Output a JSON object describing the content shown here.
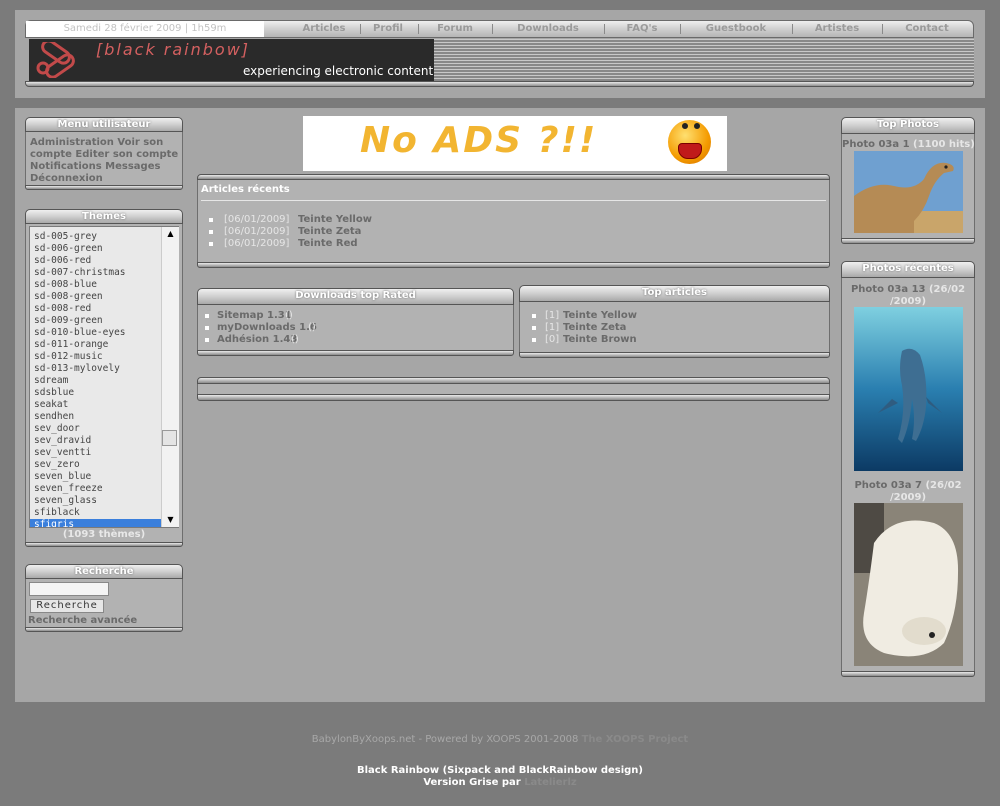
{
  "header": {
    "date": "Samedi 28 février 2009 | 1h59m",
    "nav": [
      "Articles",
      "Profil",
      "Forum",
      "Downloads",
      "FAQ's",
      "Guestbook",
      "Artistes",
      "Contact"
    ],
    "logo_text": "[black rainbow]",
    "tagline": "experiencing electronic content"
  },
  "user_menu": {
    "title": "Menu utilisateur",
    "lines": [
      "Administration Voir son",
      "compte Editer son compte",
      "Notifications Messages",
      "Déconnexion"
    ]
  },
  "themes": {
    "title": "Themes",
    "items": [
      "sd-005-grey",
      "sd-006-green",
      "sd-006-red",
      "sd-007-christmas",
      "sd-008-blue",
      "sd-008-green",
      "sd-008-red",
      "sd-009-green",
      "sd-010-blue-eyes",
      "sd-011-orange",
      "sd-012-music",
      "sd-013-mylovely",
      "sdream",
      "sdsblue",
      "seakat",
      "sendhen",
      "sev_door",
      "sev_dravid",
      "sev_ventti",
      "sev_zero",
      "seven_blue",
      "seven_freeze",
      "seven_glass",
      "sfiblack",
      "sfigris"
    ],
    "selected": "sfigris",
    "count_label": "(1093 thèmes)"
  },
  "search": {
    "title": "Recherche",
    "button": "Recherche",
    "advanced": "Recherche avancée"
  },
  "ads": {
    "text": "No ADS ?!!"
  },
  "recent_articles": {
    "title": "Articles récents",
    "items": [
      {
        "date": "[06/01/2009]",
        "title": "Teinte Yellow"
      },
      {
        "date": "[06/01/2009]",
        "title": "Teinte Zeta"
      },
      {
        "date": "[06/01/2009]",
        "title": "Teinte Red"
      }
    ]
  },
  "downloads": {
    "title": "Downloads top Rated",
    "items": [
      {
        "name": "Sitemap 1.31",
        "extra": "()"
      },
      {
        "name": "myDownloads 1.6",
        "extra": "()"
      },
      {
        "name": "Adhésion 1.43",
        "extra": "()"
      }
    ]
  },
  "top_articles": {
    "title": "Top articles",
    "items": [
      {
        "count": "[1]",
        "title": "Teinte Yellow"
      },
      {
        "count": "[1]",
        "title": "Teinte Zeta"
      },
      {
        "count": "[0]",
        "title": "Teinte Brown"
      }
    ]
  },
  "top_photos": {
    "title": "Top Photos",
    "caption": "Photo 03a 1",
    "hits": "(1100 hits)"
  },
  "recent_photos": {
    "title": "Photos récentes",
    "items": [
      {
        "caption": "Photo 03a 13",
        "date_a": "(26/02",
        "date_b": "/2009)"
      },
      {
        "caption": "Photo 03a 7",
        "date_a": "(26/02",
        "date_b": "/2009)"
      }
    ]
  },
  "footer": {
    "powered": "BabylonByXoops.net - Powered by XOOPS 2001-2008",
    "project": "The XOOPS Project",
    "design": "Black Rainbow (Sixpack and BlackRainbow design)",
    "version": "Version Grise par",
    "author": "Latelierlz"
  }
}
